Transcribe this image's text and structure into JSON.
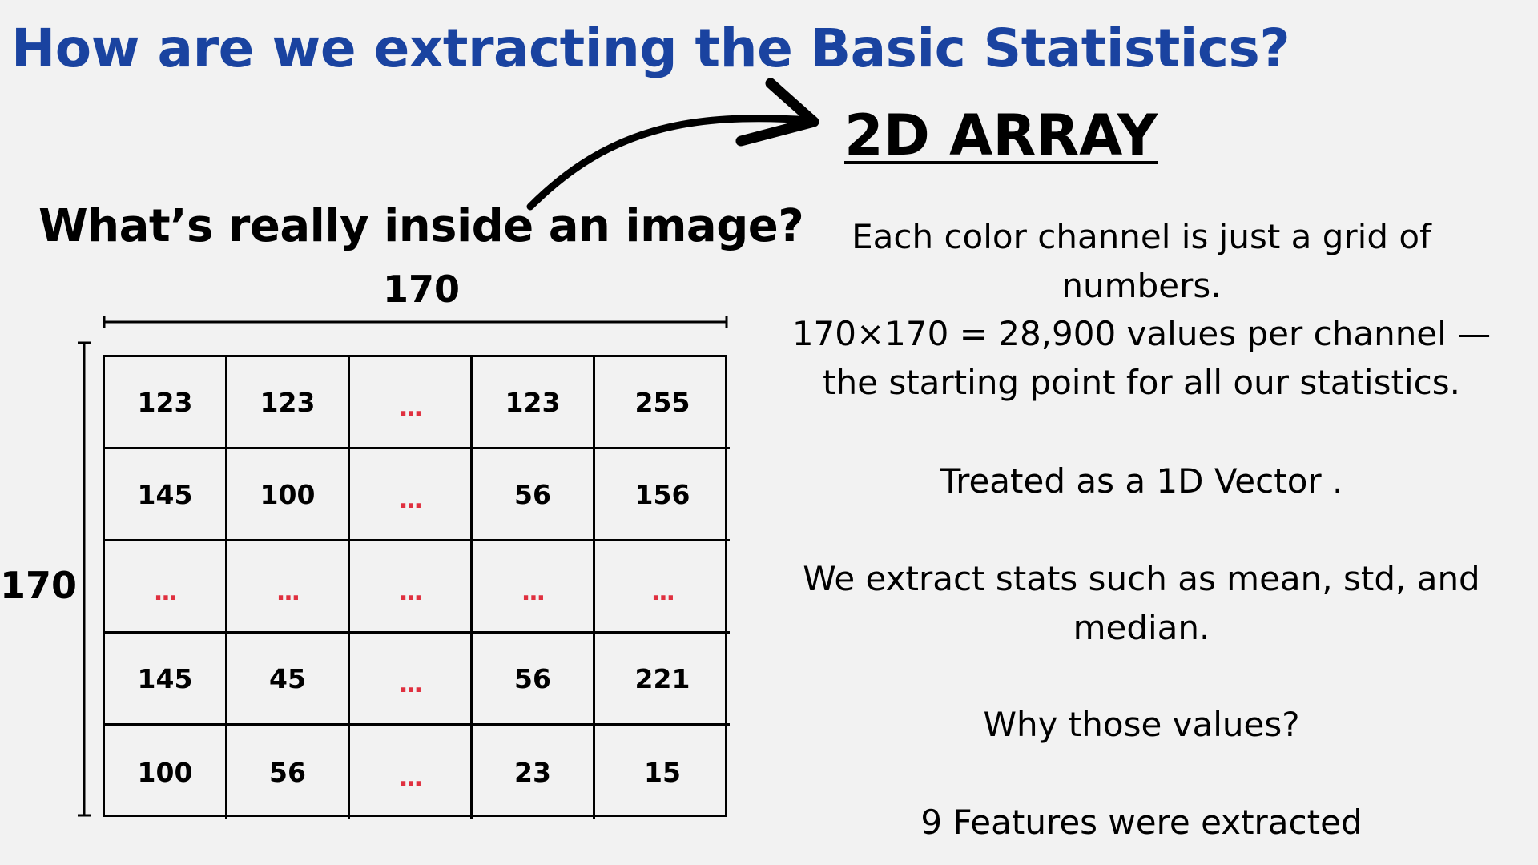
{
  "title": "How are we extracting the Basic Statistics?",
  "array_heading": "2D ARRAY",
  "subheading": "What’s really inside an image?",
  "dimensions": {
    "width_label": "170",
    "height_label": "170"
  },
  "grid": {
    "rows": [
      [
        "123",
        "123",
        "...",
        "123",
        "255"
      ],
      [
        "145",
        "100",
        "...",
        "56",
        "156"
      ],
      [
        "...",
        "...",
        "...",
        "...",
        "..."
      ],
      [
        "145",
        "45",
        "...",
        "56",
        "221"
      ],
      [
        "100",
        "56",
        "...",
        "23",
        "15"
      ]
    ],
    "ellipsis_color": "#e0303f"
  },
  "paragraphs": [
    "Each color channel is just a grid of numbers.",
    "170×170 = 28,900 values per channel — the starting point for all our statistics.",
    "Treated as a 1D Vector .",
    "We extract stats such as  mean, std, and median.",
    "Why those values?",
    "9 Features were extracted"
  ],
  "colors": {
    "title": "#1a43a0",
    "background": "#f2f2f2",
    "text": "#000000"
  },
  "icons": {
    "arrow": "curved-arrow-icon"
  }
}
